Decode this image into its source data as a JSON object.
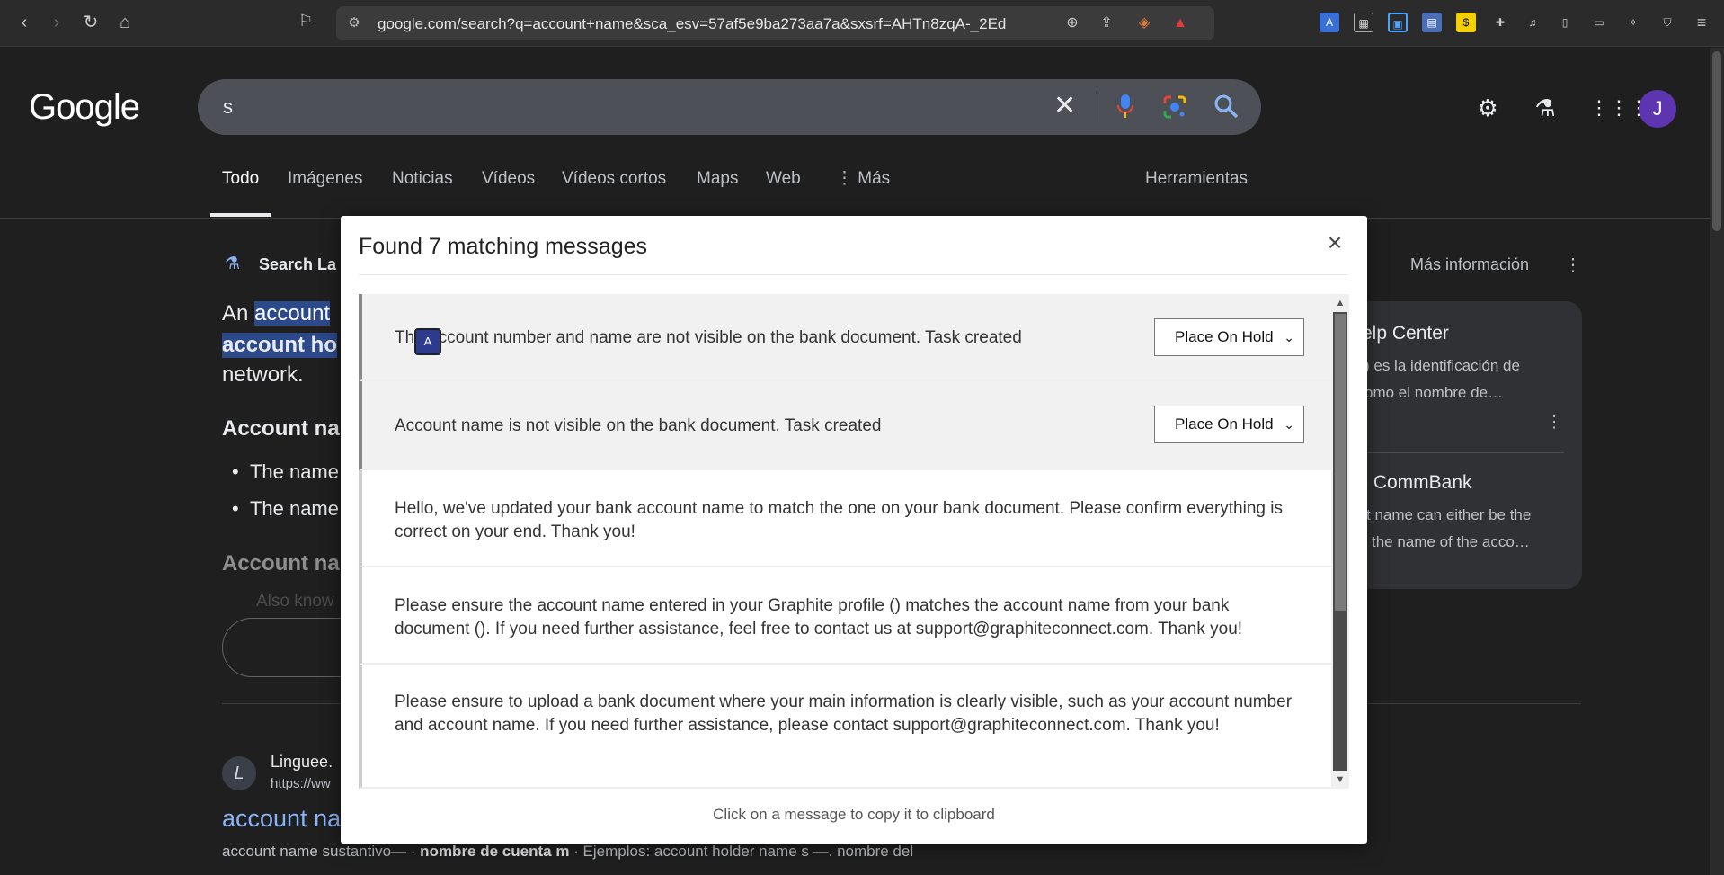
{
  "browser": {
    "url": "google.com/search?q=account+name&sca_esv=57af5e9ba273aa7a&sxsrf=AHTn8zqA-_2EdK0..."
  },
  "google": {
    "logo": "Google",
    "query": "s",
    "tabs": [
      "Todo",
      "Imágenes",
      "Noticias",
      "Vídeos",
      "Vídeos cortos",
      "Maps",
      "Web",
      "Más"
    ],
    "tools": "Herramientas",
    "avatar_letter": "J",
    "search_labs": "Search La",
    "mas_info": "Más información",
    "overview_line1a": "An ",
    "overview_line1b": "account",
    "overview_line2": "account ho",
    "overview_line3": "network.",
    "heading_account": "Account na",
    "bullet1": "The name",
    "bullet2": "The name",
    "heading_account2": "Account na",
    "bullet_faded": "Also know",
    "side_card1_title": "elp Center",
    "side_card1_text1": ") es la identificación de",
    "side_card1_text2": "omo el nombre de…",
    "side_card2_title": "- CommBank",
    "side_card2_text1": "t name can either be the",
    "side_card2_text2": "the name of the acco…",
    "result_site": "Linguee.",
    "result_url": "https://ww",
    "result_title": "account na",
    "result_snippet_a": "account name sustantivo— · ",
    "result_snippet_b": "nombre de cuenta m",
    "result_snippet_c": " · Ejemplos: account holder name s —. nombre del"
  },
  "modal": {
    "title": "Found 7 matching messages",
    "close": "×",
    "footer": "Click on a message to copy it to clipboard",
    "messages": [
      {
        "text": "The account number and name are not visible on the bank document. Task created",
        "status": "Place On Hold"
      },
      {
        "text": "Account name is not visible on the bank document. Task created",
        "status": "Place On Hold"
      },
      {
        "text": "Hello, we've updated your bank account name to match the one on your bank document. Please confirm everything is correct on your end. Thank you!"
      },
      {
        "text": "Please ensure the account name entered in your Graphite profile () matches the account name from your bank document (). If you need further assistance, feel free to contact us at support@graphiteconnect.com. Thank you!"
      },
      {
        "text": "Please ensure to upload a bank document where your main information is clearly visible, such as your account number and account name. If you need further assistance, please contact support@graphiteconnect.com. Thank you!"
      }
    ]
  }
}
